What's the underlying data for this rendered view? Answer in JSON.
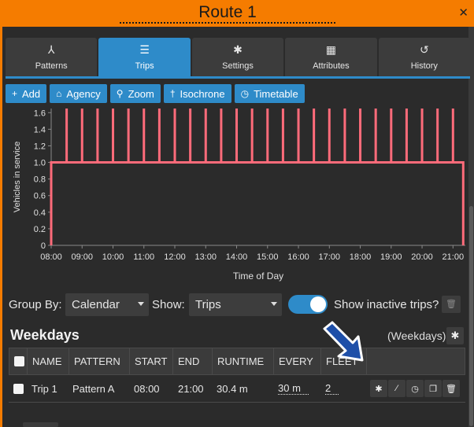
{
  "window": {
    "title": "Route 1",
    "close_icon": "close-icon"
  },
  "tabs": [
    {
      "label": "Patterns",
      "icon": "pattern-icon",
      "glyph": "⅄",
      "active": false
    },
    {
      "label": "Trips",
      "icon": "list-icon",
      "glyph": "☰",
      "active": true
    },
    {
      "label": "Settings",
      "icon": "gear-icon",
      "glyph": "✱",
      "active": false
    },
    {
      "label": "Attributes",
      "icon": "grid-icon",
      "glyph": "▦",
      "active": false
    },
    {
      "label": "History",
      "icon": "history-icon",
      "glyph": "↺",
      "active": false
    }
  ],
  "toolbar": [
    {
      "label": "Add",
      "icon": "plus-icon",
      "glyph": "+"
    },
    {
      "label": "Agency",
      "icon": "bank-icon",
      "glyph": "⌂"
    },
    {
      "label": "Zoom",
      "icon": "search-icon",
      "glyph": "⚲"
    },
    {
      "label": "Isochrone",
      "icon": "pin-icon",
      "glyph": "†"
    },
    {
      "label": "Timetable",
      "icon": "clock-icon",
      "glyph": "◷"
    }
  ],
  "chart_data": {
    "type": "line",
    "xlabel": "Time of Day",
    "ylabel": "Vehicles in service",
    "x_ticks": [
      "08:00",
      "09:00",
      "10:00",
      "11:00",
      "12:00",
      "13:00",
      "14:00",
      "15:00",
      "16:00",
      "17:00",
      "18:00",
      "19:00",
      "20:00",
      "21:00"
    ],
    "y_ticks": [
      "0",
      "0.2",
      "0.4",
      "0.6",
      "0.8",
      "1.0",
      "1.2",
      "1.4",
      "1.6"
    ],
    "ylim": [
      0,
      1.65
    ],
    "xlim_hours": [
      8,
      21.4
    ],
    "line_color": "#ff6b7a",
    "series": [
      {
        "x_hours": [
          8.0,
          8.0,
          21.33,
          21.33
        ],
        "y": [
          0,
          1,
          1,
          0
        ],
        "spikes_to": 1.65,
        "spike_x_hours": [
          8.5,
          9.0,
          9.5,
          10.0,
          10.5,
          11.0,
          11.5,
          12.0,
          12.5,
          13.0,
          13.5,
          14.0,
          14.5,
          15.0,
          15.5,
          16.0,
          16.5,
          17.0,
          17.5,
          18.0,
          18.5,
          19.0,
          19.5,
          20.0,
          20.5,
          21.0
        ]
      }
    ]
  },
  "controls": {
    "group_by_label": "Group By:",
    "group_by_value": "Calendar",
    "show_label": "Show:",
    "show_value": "Trips",
    "inactive_label": "Show inactive trips?",
    "inactive_on": true
  },
  "section": {
    "title": "Weekdays",
    "calendar": "(Weekdays)"
  },
  "table": {
    "headers": [
      "NAME",
      "PATTERN",
      "START",
      "END",
      "RUNTIME",
      "EVERY",
      "FLEET"
    ],
    "rows": [
      {
        "name": "Trip 1",
        "pattern": "Pattern A",
        "start": "08:00",
        "end": "21:00",
        "runtime": "30.4 m",
        "every": "30 m",
        "fleet": "2"
      }
    ]
  },
  "colors": {
    "accent": "#2e8bc9",
    "header": "#f57c00",
    "background": "#2b2b2b"
  }
}
